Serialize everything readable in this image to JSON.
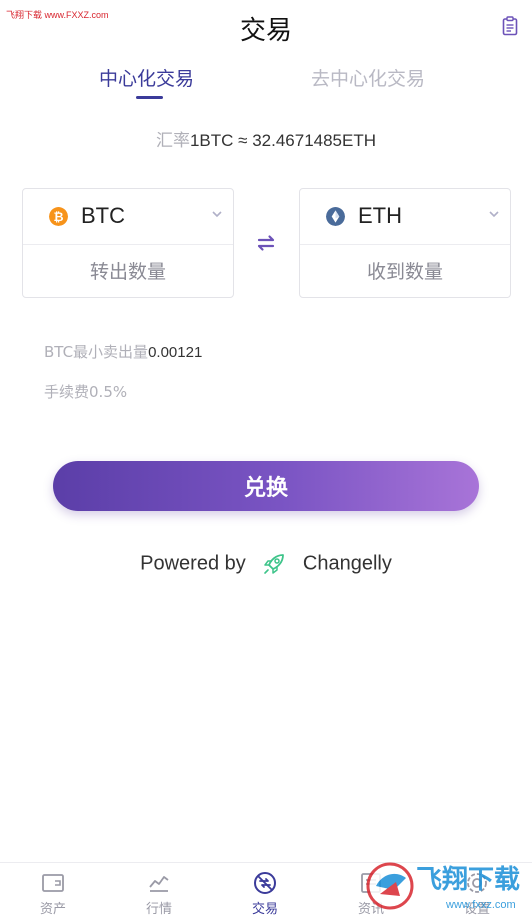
{
  "watermark": {
    "top_text": "飞翔下载 www.FXXZ.com",
    "logo_text": "飞翔下载",
    "logo_sub": "www.fxxz.com"
  },
  "header": {
    "title": "交易",
    "history_icon": "clipboard-list-icon"
  },
  "tabs": [
    {
      "label": "中心化交易",
      "active": true
    },
    {
      "label": "去中心化交易",
      "active": false
    }
  ],
  "rate": {
    "label": "汇率",
    "value": "1BTC ≈ 32.4671485ETH"
  },
  "from": {
    "coin": "BTC",
    "icon": "bitcoin-icon",
    "color": "#f7931a",
    "placeholder": "转出数量"
  },
  "to": {
    "coin": "ETH",
    "icon": "ethereum-icon",
    "color": "#627eea",
    "placeholder": "收到数量"
  },
  "info": {
    "min_label": "BTC最小卖出量",
    "min_value": "0.00121",
    "fee_label": "手续费",
    "fee_value": "0.5%"
  },
  "exchange_button": "兑换",
  "powered": {
    "prefix": "Powered by",
    "brand": "Changelly"
  },
  "nav": [
    {
      "label": "资产",
      "icon": "wallet-icon",
      "active": false
    },
    {
      "label": "行情",
      "icon": "chart-icon",
      "active": false
    },
    {
      "label": "交易",
      "icon": "exchange-icon",
      "active": true
    },
    {
      "label": "资讯",
      "icon": "news-icon",
      "active": false
    },
    {
      "label": "设置",
      "icon": "settings-icon",
      "active": false
    }
  ],
  "colors": {
    "accent": "#3b3b9a",
    "button_start": "#5b3ea8",
    "button_end": "#a874d8",
    "rocket": "#3ec48a"
  }
}
